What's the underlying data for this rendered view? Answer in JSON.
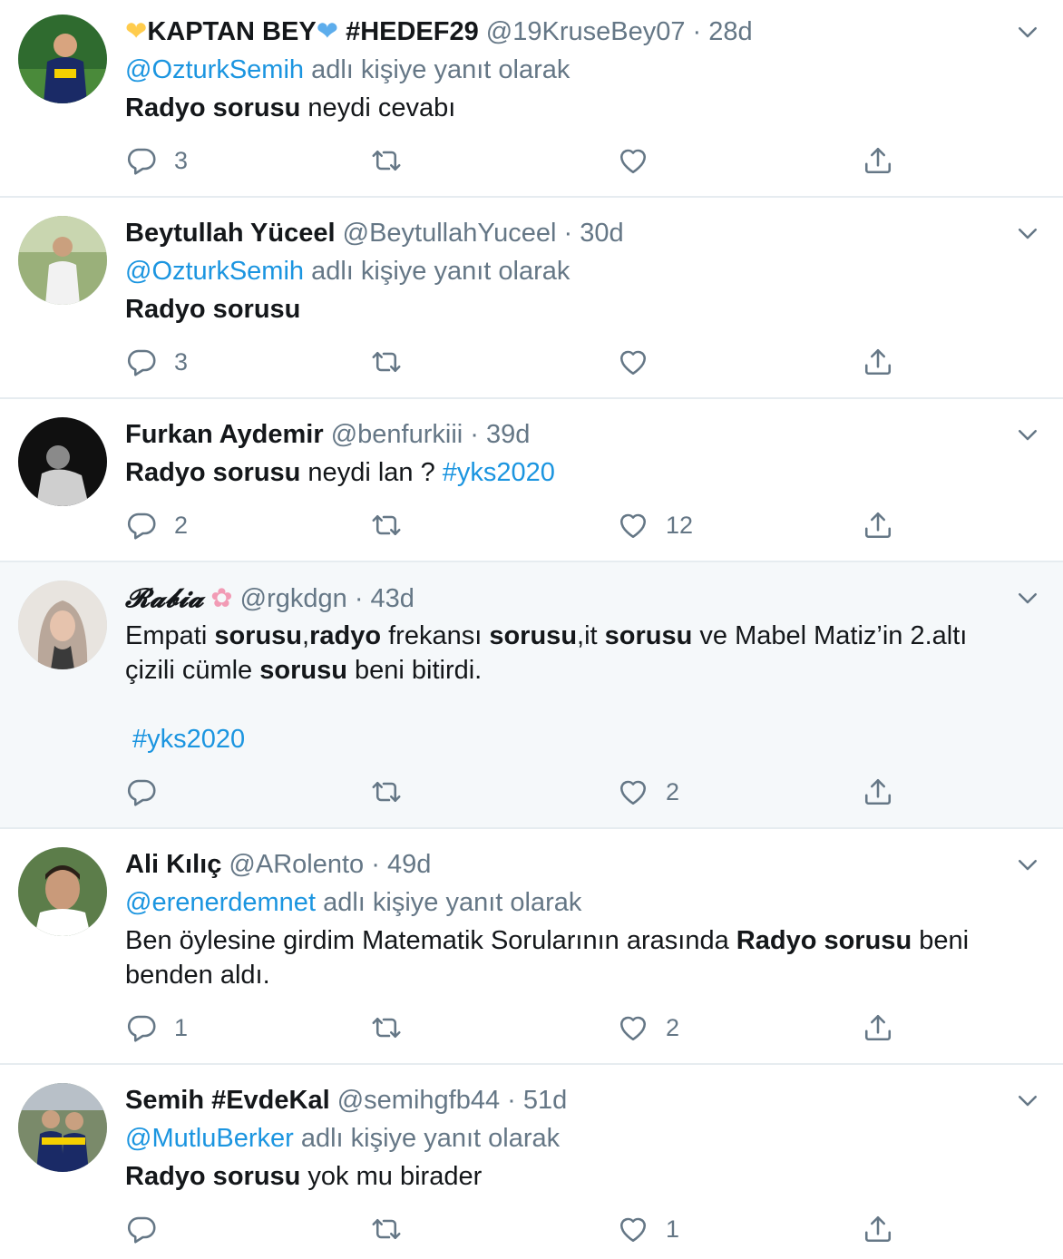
{
  "colors": {
    "link": "#1b95e0",
    "muted": "#657786",
    "text": "#14171a",
    "highlight_bg": "#f5f8fa",
    "divider": "#e6ecf0"
  },
  "reply_suffix": "adlı kişiye yanıt olarak",
  "tweets": [
    {
      "name": "KAPTAN BEY",
      "name_tail": "#HEDEF29",
      "name_emoji_left": "yellow-heart",
      "name_emoji_right": "blue-heart",
      "handle": "@19KruseBey07",
      "time": "28d",
      "reply_to": "@OzturkSemih",
      "text_bold": "Radyo sorusu",
      "text_rest": " neydi cevabı",
      "replies": "3",
      "retweets": "",
      "likes": ""
    },
    {
      "name": "Beytullah Yüceel",
      "handle": "@BeytullahYuceel",
      "time": "30d",
      "reply_to": "@OzturkSemih",
      "text_bold": "Radyo sorusu",
      "text_rest": "",
      "replies": "3",
      "retweets": "",
      "likes": ""
    },
    {
      "name": "Furkan Aydemir",
      "handle": "@benfurkiii",
      "time": "39d",
      "text_bold": "Radyo sorusu",
      "text_rest": " neydi lan ? ",
      "hashtag": "#yks2020",
      "replies": "2",
      "retweets": "",
      "likes": "12"
    },
    {
      "name": "𝓡𝓪𝓫𝓲𝓪",
      "name_emoji_right": "cherry-blossom",
      "handle": "@rgkdgn",
      "time": "43d",
      "segments": [
        "Empati ",
        "sorusu",
        ",",
        "radyo",
        " frekansı ",
        "sorusu",
        ",it ",
        "sorusu",
        " ve Mabel Matiz’in 2.altı çizili cümle ",
        "sorusu",
        " beni bitirdi."
      ],
      "hashtag": "#yks2020",
      "replies": "",
      "retweets": "",
      "likes": "2"
    },
    {
      "name": "Ali Kılıç",
      "handle": "@ARolento",
      "time": "49d",
      "reply_to": "@erenerdemnet",
      "text_pre": "Ben öylesine girdim Matematik Sorularının arasında ",
      "text_bold": "Radyo sorusu",
      "text_rest": " beni benden aldı.",
      "replies": "1",
      "retweets": "",
      "likes": "2"
    },
    {
      "name": "Semih #EvdeKal",
      "handle": "@semihgfb44",
      "time": "51d",
      "reply_to": "@MutluBerker",
      "text_bold": "Radyo sorusu",
      "text_rest": " yok mu birader",
      "replies": "",
      "retweets": "",
      "likes": "1"
    }
  ]
}
